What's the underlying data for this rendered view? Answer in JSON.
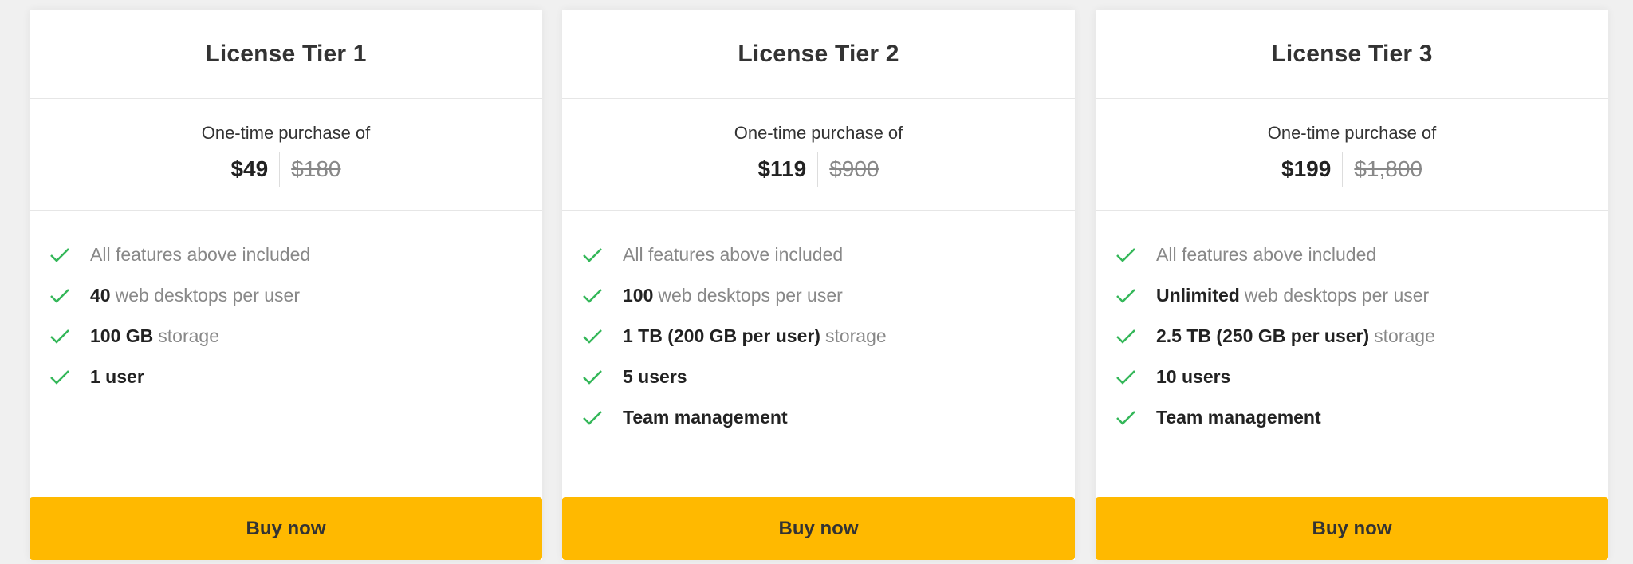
{
  "tiers": [
    {
      "title": "License Tier 1",
      "caption": "One-time purchase of",
      "price": "$49",
      "old_price": "$180",
      "features": [
        {
          "bold": "",
          "rest": "All features above included"
        },
        {
          "bold": "40",
          "rest": "web desktops per user"
        },
        {
          "bold": "100 GB",
          "rest": "storage"
        },
        {
          "bold": "1 user",
          "rest": ""
        }
      ],
      "cta": "Buy now"
    },
    {
      "title": "License Tier 2",
      "caption": "One-time purchase of",
      "price": "$119",
      "old_price": "$900",
      "features": [
        {
          "bold": "",
          "rest": "All features above included"
        },
        {
          "bold": "100",
          "rest": "web desktops per user"
        },
        {
          "bold": "1 TB (200 GB per user)",
          "rest": "storage"
        },
        {
          "bold": "5 users",
          "rest": ""
        },
        {
          "bold": "Team management",
          "rest": ""
        }
      ],
      "cta": "Buy now"
    },
    {
      "title": "License Tier 3",
      "caption": "One-time purchase of",
      "price": "$199",
      "old_price": "$1,800",
      "features": [
        {
          "bold": "",
          "rest": "All features above included"
        },
        {
          "bold": "Unlimited",
          "rest": "web desktops per user"
        },
        {
          "bold": "2.5 TB (250 GB per user)",
          "rest": "storage"
        },
        {
          "bold": "10 users",
          "rest": ""
        },
        {
          "bold": "Team management",
          "rest": ""
        }
      ],
      "cta": "Buy now"
    }
  ],
  "icons": {
    "feature": "check-icon"
  },
  "colors": {
    "accent": "#ffb900",
    "check": "#34b759",
    "muted_text": "#888888"
  }
}
